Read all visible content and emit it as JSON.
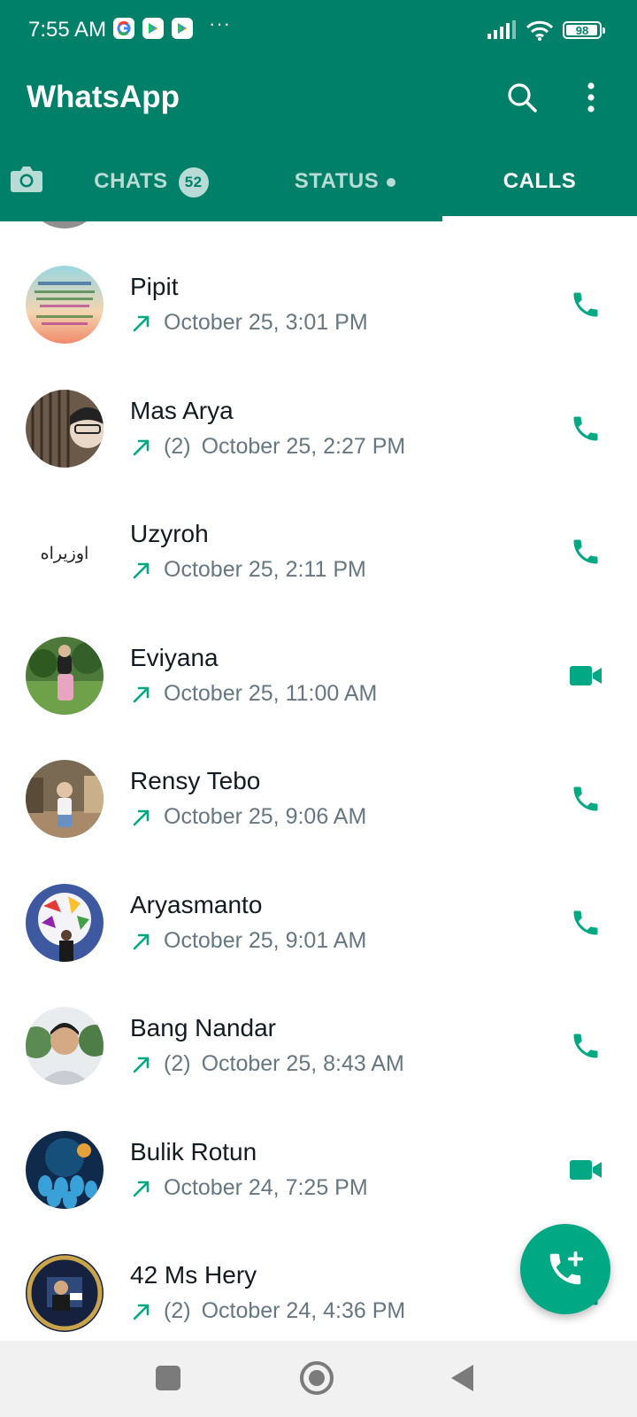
{
  "status_bar": {
    "time": "7:55 AM",
    "more": "···",
    "battery": "98",
    "battery_level": 0.98
  },
  "header": {
    "title": "WhatsApp",
    "search_icon": "search-icon",
    "menu_icon": "more-vert-icon"
  },
  "tabs": {
    "camera_icon": "camera-icon",
    "chats": {
      "label": "CHATS",
      "badge": "52"
    },
    "status": {
      "label": "STATUS"
    },
    "calls": {
      "label": "CALLS"
    }
  },
  "calls": [
    {
      "name": "Pipit",
      "count": "",
      "time": "October 25, 3:01 PM",
      "type": "voice"
    },
    {
      "name": "Mas Arya",
      "count": "(2)",
      "time": "October 25, 2:27 PM",
      "type": "voice"
    },
    {
      "name": "Uzyroh",
      "count": "",
      "time": "October 25, 2:11 PM",
      "type": "voice"
    },
    {
      "name": "Eviyana",
      "count": "",
      "time": "October 25, 11:00 AM",
      "type": "video"
    },
    {
      "name": "Rensy Tebo",
      "count": "",
      "time": "October 25, 9:06 AM",
      "type": "voice"
    },
    {
      "name": "Aryasmanto",
      "count": "",
      "time": "October 25, 9:01 AM",
      "type": "voice"
    },
    {
      "name": "Bang Nandar",
      "count": "(2)",
      "time": "October 25, 8:43 AM",
      "type": "voice"
    },
    {
      "name": "Bulik Rotun",
      "count": "",
      "time": "October 24, 7:25 PM",
      "type": "video"
    },
    {
      "name": "42 Ms Hery",
      "count": "(2)",
      "time": "October 24, 4:36 PM",
      "type": "voice"
    }
  ],
  "avatar_text": {
    "uzyroh": "اوزيراه"
  },
  "colors": {
    "brand": "#008069",
    "accent": "#00a884",
    "outgoing_arrow": "#00a884"
  },
  "fab": {
    "icon": "new-call-icon"
  },
  "nav": {
    "recents_icon": "recents-square-icon",
    "home_icon": "home-circle-icon",
    "back_icon": "back-triangle-icon"
  }
}
